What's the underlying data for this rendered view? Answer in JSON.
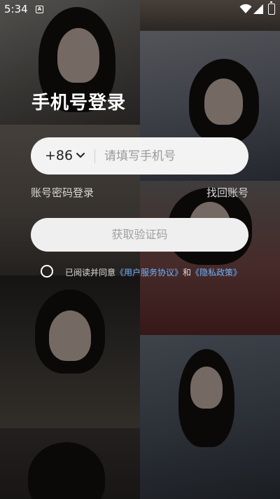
{
  "status_bar": {
    "time": "5:34",
    "notification_letter": "A",
    "icons": [
      "wifi-icon",
      "signal-icon",
      "battery-icon"
    ]
  },
  "login": {
    "title": "手机号登录",
    "country_code": "+86",
    "phone_placeholder": "请填写手机号",
    "phone_value": "",
    "password_login_link": "账号密码登录",
    "recover_account_link": "找回账号",
    "get_code_button": "获取验证码",
    "agreement": {
      "prefix": "已阅读并同意",
      "user_agreement": "《用户服务协议》",
      "conjunction": "和",
      "privacy_policy": "《隐私政策》",
      "checked": false
    }
  },
  "colors": {
    "button_bg": "#efefef",
    "button_text": "#a0a0a0",
    "link_blue": "#6fb4ff",
    "input_bg": "#f3f3f3"
  }
}
